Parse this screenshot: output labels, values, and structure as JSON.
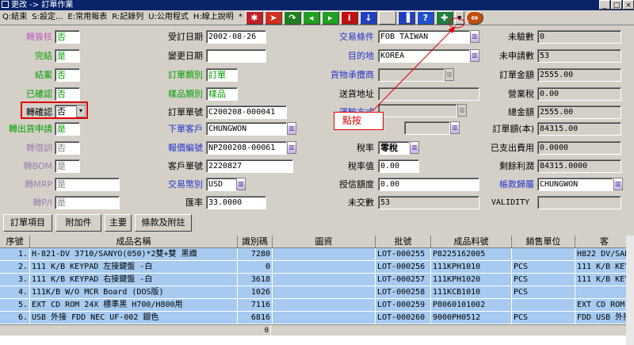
{
  "window": {
    "title": "更改 -> 訂單作業"
  },
  "menu": [
    "Q:結束",
    "S:設定...",
    "E:常用報表",
    "R:記錄列",
    "U:公用程式",
    "H:線上說明",
    "*"
  ],
  "form": {
    "l1": "轉簽核",
    "v1": "否",
    "l2": "完結",
    "v2": "是",
    "l3": "結案",
    "v3": "否",
    "l4": "已確認",
    "v4": "否",
    "l5": "轉確認",
    "v5": "否",
    "l6": "轉出貨申請",
    "v6": "是",
    "l7": "轉借訓",
    "v7": "否",
    "l8": "轉BOM",
    "v8": "是",
    "l9": "轉MRP",
    "v9": "是",
    "l10": "轉P/I",
    "v10": "是",
    "m1": "受訂日期",
    "mv1": "2002-08-26",
    "m2": "變更日期",
    "mv2": "",
    "m3": "訂單類別",
    "mv3": "訂單",
    "m4": "樣品類別",
    "mv4": "樣品",
    "m5": "訂單單號",
    "mv5": "C200208-000041",
    "m6": "下單客戶",
    "mv6": "CHUNGWON",
    "m7": "報價編號",
    "mv7": "NP200208-00061",
    "m8": "客戶單號",
    "mv8": "2220827",
    "m9": "交易幣別",
    "mv9": "USD",
    "m10": "匯率",
    "mv10": "33.0000",
    "c1": "交易條件",
    "cv1": "FOB TAIWAN",
    "c2": "目的地",
    "cv2": "KOREA",
    "c3": "貨物承攬商",
    "cv3": "",
    "c4": "送貨地址",
    "cv4": "",
    "c5": "運輸方式",
    "cv5": "",
    "c6": "稅率",
    "cv6": "零稅",
    "c7": "稅率值",
    "cv7": "0.00",
    "c8": "授信額度",
    "cv8": "0.00",
    "c9": "未交數",
    "cv9": "53",
    "r1": "未驗數",
    "rv1": "0",
    "r2": "未申請數",
    "rv2": "53",
    "r3": "訂單金額",
    "rv3": "2555.00",
    "r4": "營業稅",
    "rv4": "0.00",
    "r5": "總金額",
    "rv5": "2555.00",
    "r6": "訂單額(本)",
    "rv6": "84315.00",
    "r7": "已支出費用",
    "rv7": "0.0000",
    "r8": "剩餘利潤",
    "rv8": "84315.0000",
    "r9": "帳款歸屬",
    "rv9": "CHUNGWON",
    "r10": "VALIDITY",
    "rv10": ""
  },
  "annotation": "點按",
  "buttons": {
    "b1": "訂單項目",
    "b2": "附加件",
    "b3": "主要",
    "b4": "條款及附註"
  },
  "grid": {
    "headers": [
      "序號",
      "成品名稱",
      "識別碼",
      "圖資",
      "批號",
      "成品料號",
      "銷售單位",
      "客"
    ],
    "rows": [
      [
        "1.",
        "H-821-DV 3710/SANYO(050)*2雙+雙 黑織",
        "7280",
        "",
        "LOT-000255",
        "P8225162005",
        "",
        "H822 DV/SANYO("
      ],
      [
        "2.",
        "111 K/B KEYPAD 左接鍵盤 -白",
        "0",
        "",
        "LOT-000256",
        "111KPH1010",
        "PCS",
        "111 K/B KEYPA"
      ],
      [
        "3.",
        "111 K/B KEYPAD 右接鍵盤 -白",
        "3618",
        "",
        "LOT-000257",
        "111KPH1020",
        "PCS",
        "111 K/B KEYPA"
      ],
      [
        "4.",
        "111K/B W/O MCR Board (DOS版)",
        "1026",
        "",
        "LOT-000258",
        "111KCB1010",
        "PCS",
        ""
      ],
      [
        "5.",
        "EXT CD ROM 24X 標準黑 H700/H800用",
        "7116",
        "",
        "LOT-000259",
        "P8060101002",
        "",
        "EXT CD ROM 移"
      ],
      [
        "6.",
        "USB 外接 FDD NEC UF-002 銀色",
        "6816",
        "",
        "LOT-000260",
        "9000PH0512",
        "PCS",
        "FDD USB 外接"
      ]
    ],
    "footer_total": "0"
  }
}
